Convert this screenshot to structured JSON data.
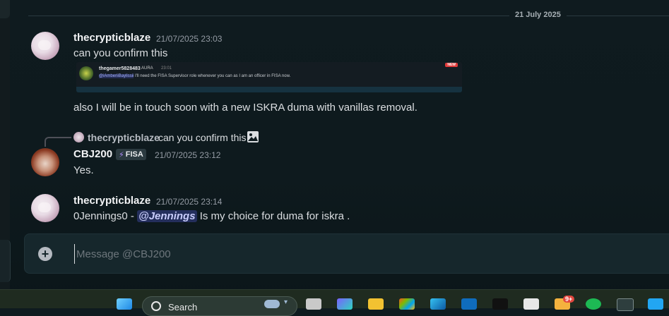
{
  "date_divider": "21 July 2025",
  "messages": [
    {
      "username": "thecrypticblaze",
      "timestamp": "21/07/2025 23:03",
      "text": "can you confirm this",
      "embed": {
        "username": "thegamer5828483",
        "tag": "AURA",
        "time": "23:01",
        "mention": "@iAmberiiBaylissii",
        "text": " I'll need the FISA Supervisor role whenever you can as I am an officer in FISA now.",
        "new_label": "NEW"
      },
      "followup": "also I will be in touch soon with a new ISKRA duma with vanillas removal."
    },
    {
      "reply": {
        "username": "thecrypticblaze",
        "text": "can you confirm this"
      },
      "username": "CBJ200",
      "badge": "FISA",
      "timestamp": "21/07/2025 23:12",
      "text": "Yes."
    },
    {
      "username": "thecrypticblaze",
      "timestamp": "21/07/2025 23:14",
      "text_before": "0Jennings0 - ",
      "mention": "@Jennings",
      "text_after": " Is my choice for duma for iskra ."
    }
  ],
  "composer": {
    "placeholder": "Message @CBJ200"
  },
  "taskbar": {
    "search_label": "Search",
    "notification_count": "9+"
  },
  "colors": {
    "background": "#0f1b1f",
    "mention": "#c9cdfb",
    "badge_bolt": "#b18cff"
  }
}
